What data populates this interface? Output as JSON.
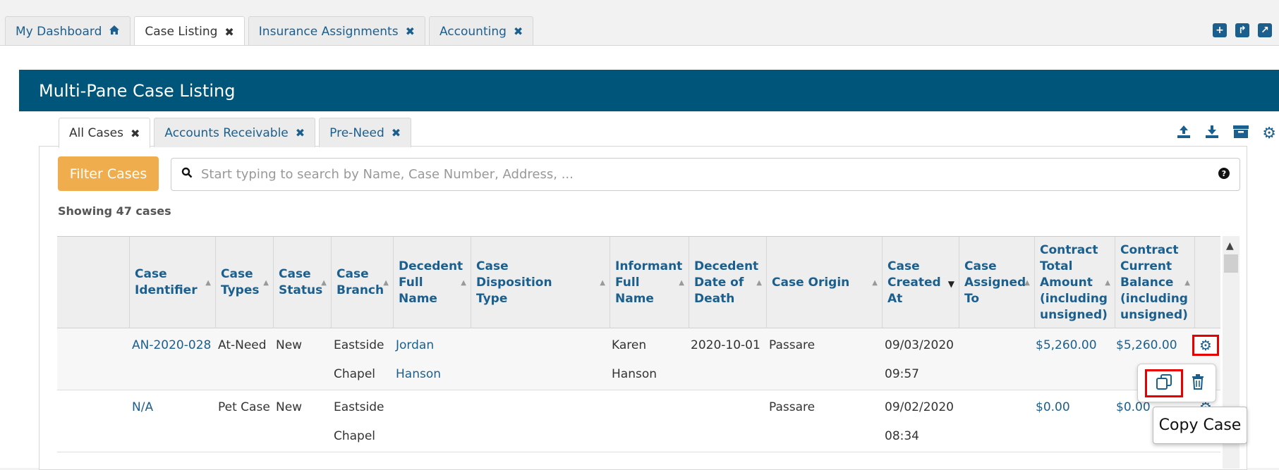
{
  "top_tabs": [
    {
      "label": "My Dashboard",
      "icon": "home-icon",
      "active": false
    },
    {
      "label": "Case Listing",
      "icon": "close-icon",
      "active": true
    },
    {
      "label": "Insurance Assignments",
      "icon": "close-icon",
      "active": false
    },
    {
      "label": "Accounting",
      "icon": "close-icon",
      "active": false
    }
  ],
  "top_actions": [
    "plus-square-icon",
    "share-square-icon",
    "external-link-square-icon"
  ],
  "pane": {
    "title": "Multi-Pane Case Listing",
    "tabs": [
      {
        "label": "All Cases",
        "active": true
      },
      {
        "label": "Accounts Receivable",
        "active": false
      },
      {
        "label": "Pre-Need",
        "active": false
      }
    ],
    "actions": [
      "upload-icon",
      "download-icon",
      "archive-icon",
      "gear-icon"
    ]
  },
  "filter_button": "Filter Cases",
  "search": {
    "placeholder": "Start typing to search by Name, Case Number, Address, ..."
  },
  "showing": "Showing 47 cases",
  "table": {
    "columns": [
      {
        "key": "id",
        "label": "Case Identifier",
        "sort": "none"
      },
      {
        "key": "types",
        "label": "Case Types",
        "sort": "none"
      },
      {
        "key": "status",
        "label": "Case Status",
        "sort": "none"
      },
      {
        "key": "branch",
        "label": "Case Branch",
        "sort": "none"
      },
      {
        "key": "decedent",
        "label": "Decedent Full Name",
        "sort": "none"
      },
      {
        "key": "disposition",
        "label": "Case Disposition Type",
        "sort": "none"
      },
      {
        "key": "informant",
        "label": "Informant Full Name",
        "sort": "none"
      },
      {
        "key": "dod",
        "label": "Decedent Date of Death",
        "sort": "none"
      },
      {
        "key": "origin",
        "label": "Case Origin",
        "sort": "none"
      },
      {
        "key": "created",
        "label": "Case Created At",
        "sort": "desc"
      },
      {
        "key": "assigned",
        "label": "Case Assigned To",
        "sort": "none"
      },
      {
        "key": "total",
        "label": "Contract Total Amount (including unsigned)",
        "sort": "none"
      },
      {
        "key": "balance",
        "label": "Contract Current Balance (including unsigned)",
        "sort": "none"
      }
    ],
    "rows": [
      {
        "id": "AN-2020-028",
        "types": "At-Need",
        "status": "New",
        "branch_line1": "Eastside",
        "branch_line2": "Chapel",
        "decedent_line1": "Jordan",
        "decedent_line2": "Hanson",
        "disposition": "",
        "informant_line1": "Karen",
        "informant_line2": "Hanson",
        "dod": "2020-10-01",
        "origin": "Passare",
        "created_line1": "09/03/2020",
        "created_line2": "09:57",
        "assigned": "",
        "total": "$5,260.00",
        "balance": "$5,260.00"
      },
      {
        "id": "N/A",
        "types": "Pet Case",
        "status": "New",
        "branch_line1": "Eastside",
        "branch_line2": "Chapel",
        "decedent_line1": "",
        "decedent_line2": "",
        "disposition": "",
        "informant_line1": "",
        "informant_line2": "",
        "dod": "",
        "origin": "Passare",
        "created_line1": "09/02/2020",
        "created_line2": "08:34",
        "assigned": "",
        "total": "$0.00",
        "balance": "$0.00"
      }
    ]
  },
  "row_actions": {
    "copy_icon": "copy-icon",
    "delete_icon": "trash-icon"
  },
  "tooltip": "Copy Case",
  "colors": {
    "header": "#00567a",
    "link": "#1a5f8e",
    "filter_button": "#f0ad4e",
    "highlight": "#e60000"
  }
}
